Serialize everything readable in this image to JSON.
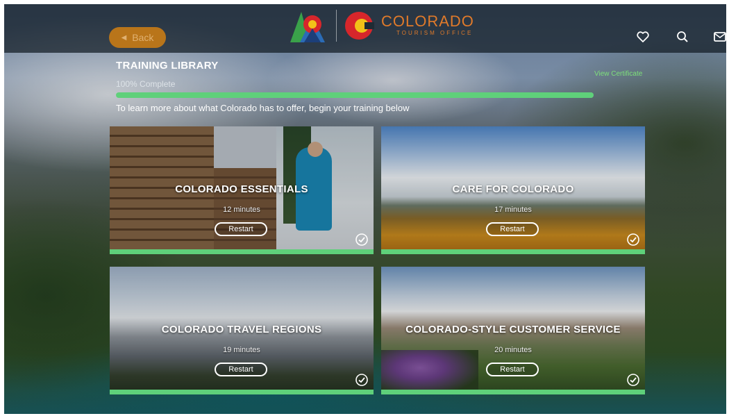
{
  "header": {
    "back_label": "Back",
    "logo_title": "COLORADO",
    "logo_subtitle": "TOURISM OFFICE",
    "icons": [
      "heart-icon",
      "search-icon",
      "mail-icon"
    ]
  },
  "library": {
    "title": "TRAINING LIBRARY",
    "completion_text": "100% Complete",
    "progress": 1.0,
    "view_certificate": "View Certificate",
    "intro": "To learn more about what Colorado has to offer, begin your training below"
  },
  "courses": [
    {
      "title": "COLORADO ESSENTIALS",
      "duration": "12 minutes",
      "action": "Restart",
      "completed": true
    },
    {
      "title": "CARE FOR COLORADO",
      "duration": "17 minutes",
      "action": "Restart",
      "completed": true
    },
    {
      "title": "COLORADO TRAVEL REGIONS",
      "duration": "19 minutes",
      "action": "Restart",
      "completed": true
    },
    {
      "title": "COLORADO-STYLE CUSTOMER SERVICE",
      "duration": "20 minutes",
      "action": "Restart",
      "completed": true
    }
  ],
  "colors": {
    "accent_green": "#5fd07a",
    "back_button": "#b9751a",
    "logo_orange": "#e07a2a"
  }
}
